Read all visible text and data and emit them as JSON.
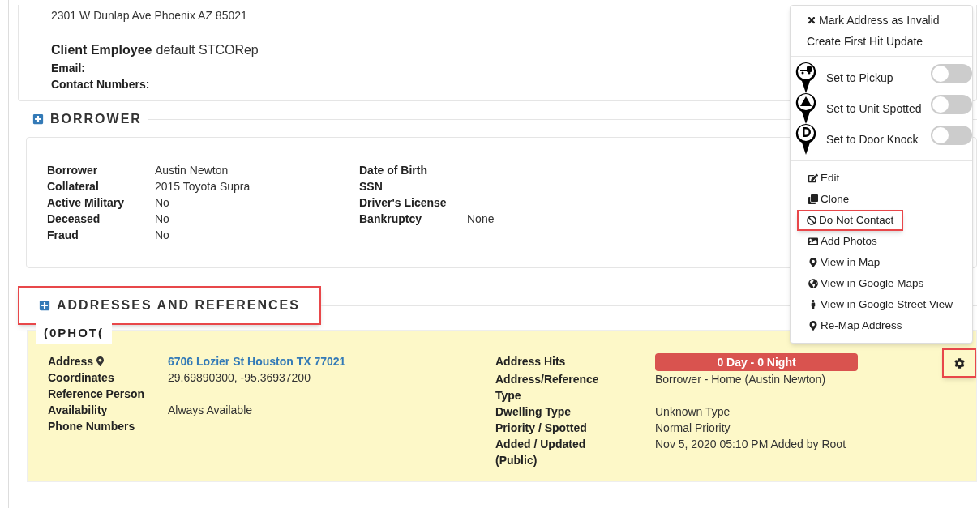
{
  "client": {
    "address": "2301 W Dunlap Ave Phoenix AZ 85021",
    "employee_label": "Client Employee",
    "employee_value": "default STCORep",
    "email_label": "Email:",
    "contacts_label": "Contact Numbers:"
  },
  "borrower": {
    "title": "BORROWER",
    "left": [
      {
        "label": "Borrower",
        "value": "Austin Newton"
      },
      {
        "label": "Collateral",
        "value": "2015 Toyota Supra"
      },
      {
        "label": "Active Military",
        "value": "No"
      },
      {
        "label": "Deceased",
        "value": "No"
      },
      {
        "label": "Fraud",
        "value": "No"
      }
    ],
    "right": [
      {
        "label": "Date of Birth"
      },
      {
        "label": "SSN"
      },
      {
        "label": "Driver's License"
      },
      {
        "label": "Bankruptcy",
        "value": "None"
      }
    ]
  },
  "addresses": {
    "title": "ADDRESSES AND REFERENCES",
    "highlighted": true,
    "photos_tab": "(0PHOT(",
    "left": [
      {
        "label": "Address",
        "value": "6706 Lozier St Houston TX 77021",
        "kind": "link"
      },
      {
        "label": "Coordinates",
        "value": "29.69890300, -95.36937200",
        "kind": "text"
      },
      {
        "label": "Reference Person",
        "kind": "text"
      },
      {
        "label": "Availability",
        "value": "Always Available",
        "kind": "text"
      },
      {
        "label": "Phone Numbers",
        "kind": "text"
      }
    ],
    "right": [
      {
        "label": "Address Hits",
        "value": "0 Day - 0 Night",
        "kind": "badge"
      },
      {
        "label": "Address/Reference Type",
        "value": "Borrower - Home (Austin Newton)",
        "kind": "text"
      },
      {
        "label": "Dwelling Type",
        "value": "Unknown Type",
        "kind": "text"
      },
      {
        "label": "Priority / Spotted",
        "value": "Normal Priority",
        "kind": "text"
      },
      {
        "label": "Added / Updated (Public)",
        "value": "Nov 5, 2020 05:10 PM Added by Root",
        "kind": "text"
      }
    ],
    "gear_highlighted": true
  },
  "menu": {
    "top": [
      {
        "label": "Mark Address as Invalid",
        "kind": "x"
      },
      {
        "label": "Create First Hit Update",
        "kind": "plain"
      }
    ],
    "toggles": [
      {
        "label": "Set to Pickup",
        "kind": "truck",
        "on": false
      },
      {
        "label": "Set to Unit Spotted",
        "kind": "warning",
        "on": false
      },
      {
        "label": "Set to Door Knock",
        "kind": "d",
        "on": false
      }
    ],
    "items": [
      {
        "label": "Edit",
        "kind": "edit",
        "highlighted": false
      },
      {
        "label": "Clone",
        "kind": "clone",
        "highlighted": false
      },
      {
        "label": "Do Not Contact",
        "kind": "ban",
        "highlighted": true
      },
      {
        "label": "Add Photos",
        "kind": "image",
        "highlighted": false
      },
      {
        "label": "View in Map",
        "kind": "pin",
        "highlighted": false
      },
      {
        "label": "View in Google Maps",
        "kind": "globe",
        "highlighted": false
      },
      {
        "label": "View in Google Street View",
        "kind": "person",
        "highlighted": false
      },
      {
        "label": "Re-Map Address",
        "kind": "pin",
        "highlighted": false
      }
    ]
  }
}
